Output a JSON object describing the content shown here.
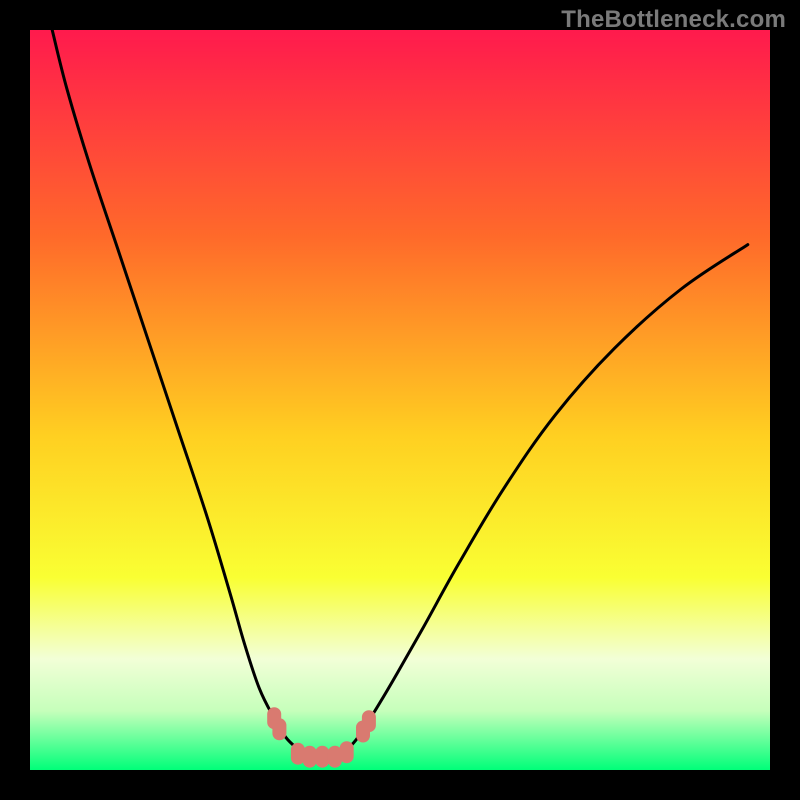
{
  "watermark": "TheBottleneck.com",
  "colors": {
    "frame": "#000000",
    "grad_top": "#ff1a4d",
    "grad_mid1": "#ff6a2a",
    "grad_mid2": "#ffd021",
    "grad_mid3": "#f9ff33",
    "grad_low1": "#f2ffd7",
    "grad_low2": "#c6ffbb",
    "grad_bottom": "#00ff79",
    "curve": "#000000",
    "nub": "#d97a70"
  },
  "chart_data": {
    "type": "line",
    "title": "",
    "xlabel": "",
    "ylabel": "",
    "xlim": [
      0,
      100
    ],
    "ylim": [
      0,
      100
    ],
    "series": [
      {
        "name": "left-branch",
        "x": [
          3,
          5,
          8,
          12,
          16,
          20,
          24,
          27,
          29,
          31,
          33,
          34.5,
          36,
          37.5
        ],
        "y": [
          100,
          92,
          82,
          70,
          58,
          46,
          34,
          24,
          17,
          11,
          7,
          4.5,
          3,
          2
        ]
      },
      {
        "name": "right-branch",
        "x": [
          42,
          44,
          46,
          49,
          53,
          58,
          64,
          71,
          79,
          88,
          97
        ],
        "y": [
          2,
          4,
          7,
          12,
          19,
          28,
          38,
          48,
          57,
          65,
          71
        ]
      },
      {
        "name": "floor",
        "x": [
          37.5,
          42
        ],
        "y": [
          2,
          2
        ]
      }
    ],
    "nubs": [
      {
        "x": 33.0,
        "y": 7.0
      },
      {
        "x": 33.7,
        "y": 5.5
      },
      {
        "x": 36.2,
        "y": 2.2
      },
      {
        "x": 37.8,
        "y": 1.8
      },
      {
        "x": 39.5,
        "y": 1.8
      },
      {
        "x": 41.2,
        "y": 1.8
      },
      {
        "x": 42.8,
        "y": 2.4
      },
      {
        "x": 45.0,
        "y": 5.2
      },
      {
        "x": 45.8,
        "y": 6.6
      }
    ]
  }
}
